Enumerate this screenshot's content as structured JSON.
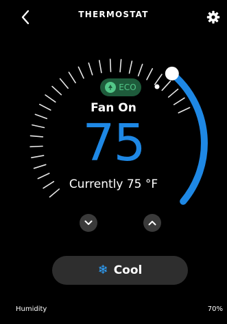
{
  "header": {
    "title": "THERMOSTAT"
  },
  "icons": {
    "back": "chevron-left-icon",
    "settings": "gear-icon",
    "eco": "leaf-icon",
    "down": "chevron-down-icon",
    "up": "chevron-up-icon",
    "mode": "snowflake-icon"
  },
  "eco": {
    "label": "ECO"
  },
  "status": {
    "fan": "Fan On"
  },
  "setpoint": {
    "value": "75"
  },
  "current": {
    "text": "Currently 75 °F"
  },
  "mode": {
    "label": "Cool",
    "glyph": "❄"
  },
  "footer": {
    "humidity_label": "Humidity",
    "humidity_value": "70%"
  },
  "colors": {
    "background": "#000000",
    "accent_blue": "#1e88e5",
    "eco_green": "#53c889",
    "eco_bg": "#1e5b3b",
    "button_bg": "#2e2e2e"
  }
}
